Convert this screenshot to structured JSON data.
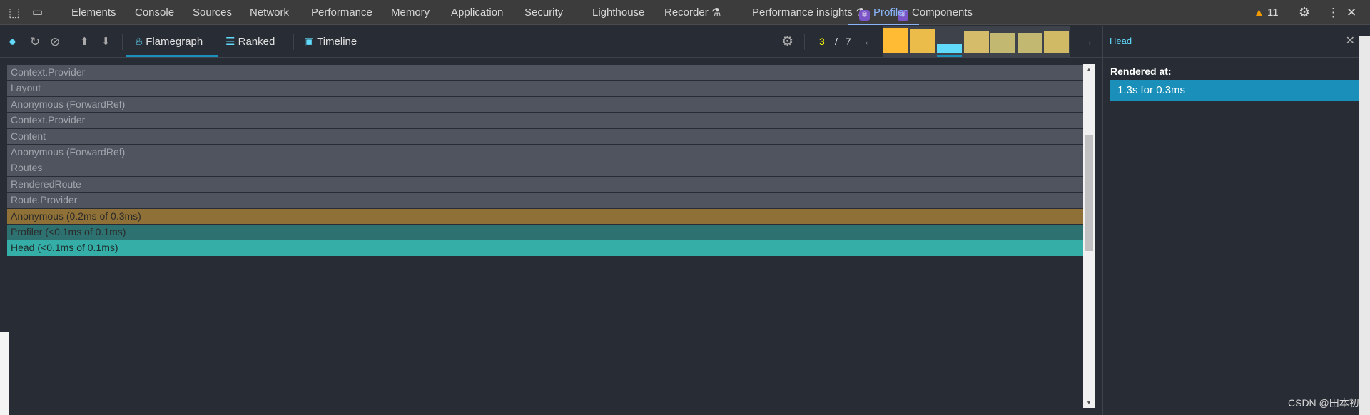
{
  "devtools_tabs": [
    {
      "label": "Elements"
    },
    {
      "label": "Console"
    },
    {
      "label": "Sources"
    },
    {
      "label": "Network"
    },
    {
      "label": "Performance"
    },
    {
      "label": "Memory"
    },
    {
      "label": "Application"
    },
    {
      "label": "Security"
    },
    {
      "label": "Lighthouse"
    },
    {
      "label": "Recorder"
    },
    {
      "label": "Performance insights"
    },
    {
      "label": "Components"
    },
    {
      "label": "Profiler"
    }
  ],
  "active_tab": "Profiler",
  "warnings_count": "11",
  "toolbar": {
    "flamegraph": "Flamegraph",
    "ranked": "Ranked",
    "timeline": "Timeline",
    "active_view": "Flamegraph",
    "commit_current": "3",
    "commit_sep": "/",
    "commit_total": "7"
  },
  "commits": {
    "relative_durations": [
      1.0,
      0.96,
      0.35,
      0.88,
      0.8,
      0.8,
      0.86
    ],
    "selected_index": 2,
    "colors": [
      "#ffbb33",
      "#ecbc4a",
      "#61dafb",
      "#d4bc6a",
      "#c2b872",
      "#c2b872",
      "#d0ba66"
    ]
  },
  "flamegraph": [
    {
      "label": "Context.Provider",
      "color": "#4f545e",
      "text": "#a0a4ab"
    },
    {
      "label": "Layout",
      "color": "#4f545e",
      "text": "#a0a4ab"
    },
    {
      "label": "Anonymous (ForwardRef)",
      "color": "#4f545e",
      "text": "#a0a4ab"
    },
    {
      "label": "Context.Provider",
      "color": "#4f545e",
      "text": "#a0a4ab"
    },
    {
      "label": "Content",
      "color": "#4f545e",
      "text": "#a0a4ab"
    },
    {
      "label": "Anonymous (ForwardRef)",
      "color": "#4f545e",
      "text": "#a0a4ab"
    },
    {
      "label": "Routes",
      "color": "#4f545e",
      "text": "#a0a4ab"
    },
    {
      "label": "RenderedRoute",
      "color": "#4f545e",
      "text": "#a0a4ab"
    },
    {
      "label": "Route.Provider",
      "color": "#4f545e",
      "text": "#a0a4ab"
    },
    {
      "label": "Anonymous (0.2ms of 0.3ms)",
      "color": "#8f7036",
      "text": "#2b2b2b"
    },
    {
      "label": "Profiler (<0.1ms of 0.1ms)",
      "color": "#2d7170",
      "text": "#2b2b2b"
    },
    {
      "label": "Head (<0.1ms of 0.1ms)",
      "color": "#34aea6",
      "text": "#1f2b2b"
    }
  ],
  "sidebar": {
    "title": "Head",
    "rendered_at_label": "Rendered at:",
    "rendered_at_value": "1.3s for 0.3ms"
  },
  "watermark": "CSDN @田本初"
}
